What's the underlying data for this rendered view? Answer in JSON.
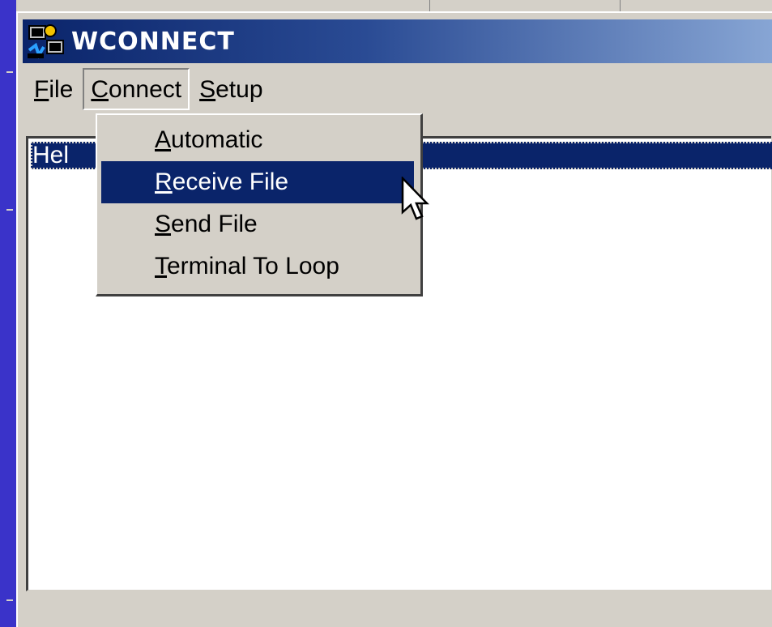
{
  "window": {
    "title": "WCONNECT",
    "icon": "wconnect-app-icon"
  },
  "menubar": {
    "items": [
      {
        "label": "File",
        "accel": "F",
        "rest": "ile"
      },
      {
        "label": "Connect",
        "accel": "C",
        "rest": "onnect"
      },
      {
        "label": "Setup",
        "accel": "S",
        "rest": "etup"
      }
    ],
    "open_menu": "Connect"
  },
  "connect_menu": {
    "items": [
      {
        "label": "Automatic",
        "accel": "A",
        "rest": "utomatic"
      },
      {
        "label": "Receive File",
        "accel": "R",
        "rest": "eceive File"
      },
      {
        "label": "Send File",
        "accel": "S",
        "rest": "end File"
      },
      {
        "label": "Terminal To Loop",
        "accel": "T",
        "rest": "erminal To Loop"
      }
    ],
    "highlighted": "Receive File"
  },
  "list": {
    "selected_row_visible_text": "Hel"
  },
  "colors": {
    "titlebar_start": "#0a246a",
    "titlebar_end": "#8aa8d6",
    "selection": "#0a246a",
    "face": "#d4d0c8",
    "desktop": "#3a33c9"
  },
  "cursor": "arrow-pointer-icon"
}
